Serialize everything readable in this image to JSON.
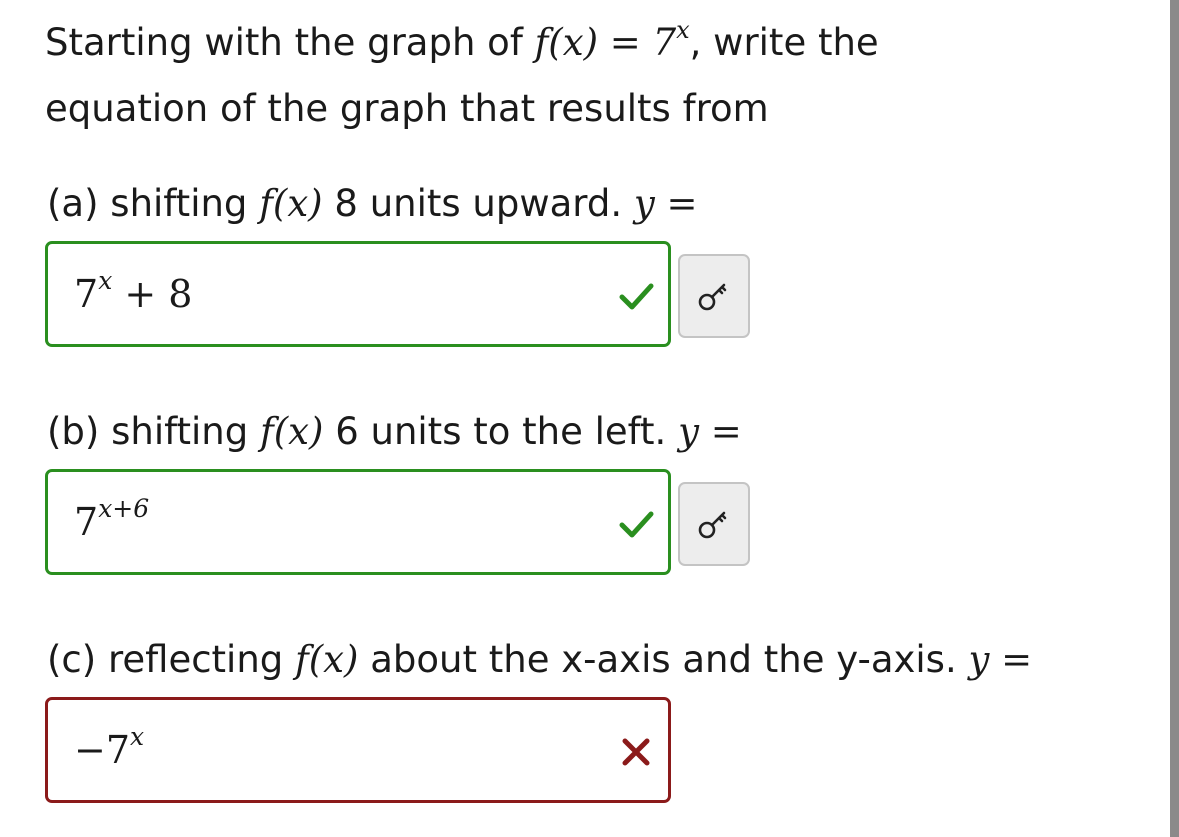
{
  "problem": {
    "intro_line1_pre": "Starting with the graph of",
    "function_def": "f(x) = 7",
    "function_exp": "x",
    "intro_line1_post": ", write the",
    "intro_line2": "equation of the graph that results from"
  },
  "parts": [
    {
      "label_pre": "(a) shifting",
      "fx": "f(x)",
      "label_post": "8 units upward.",
      "y_eq": "y =",
      "answer_base": "7",
      "answer_exp": "x",
      "answer_rest": " + 8",
      "status": "correct",
      "status_icon": "check-icon",
      "key_icon": "key-icon"
    },
    {
      "label_pre": "(b) shifting",
      "fx": "f(x)",
      "label_post": "6 units to the left.",
      "y_eq": "y =",
      "answer_base": "7",
      "answer_exp": "x+6",
      "answer_rest": "",
      "status": "correct",
      "status_icon": "check-icon",
      "key_icon": "key-icon"
    },
    {
      "label_pre": "(c) reflecting",
      "fx": "f(x)",
      "label_post": "about the x-axis and the y-axis.",
      "y_eq": "y =",
      "answer_base": "−7",
      "answer_exp": "x",
      "answer_rest": "",
      "status": "incorrect",
      "status_icon": "cross-icon"
    }
  ],
  "colors": {
    "correct": "#2a8f1f",
    "incorrect": "#8b1a1a",
    "scrollbar": "#8a8a8a"
  }
}
